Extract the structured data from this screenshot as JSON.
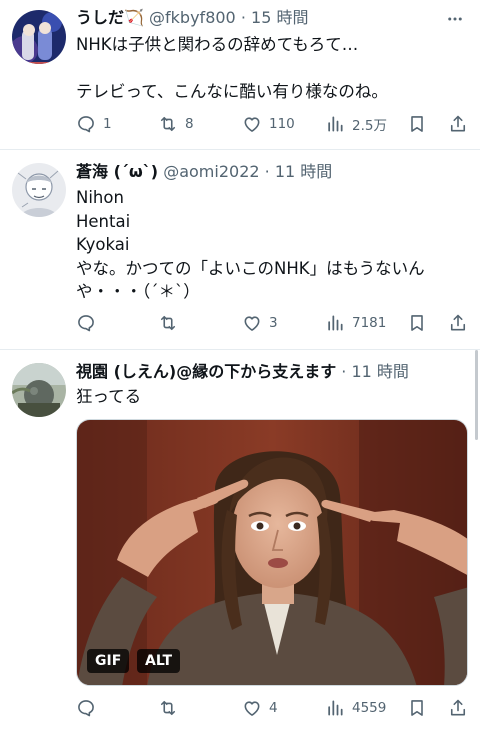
{
  "tweets": [
    {
      "name": "うしだ🏹",
      "handle": "@fkbyf800",
      "sep": "·",
      "time": "15 時間",
      "text": "NHKは子供と関わるの辞めてもろて…\n\nテレビって、こんなに酷い有り様なのね。",
      "replies": "1",
      "retweets": "8",
      "likes": "110",
      "views": "2.5万"
    },
    {
      "name": "蒼海 (´ω`)",
      "handle": "@aomi2022",
      "sep": "·",
      "time": "11 時間",
      "text": "Nihon\nHentai\nKyokai\nやな。かつての「よいこのNHK」はもうないん\nや・・・（´＊`）",
      "replies": "",
      "retweets": "",
      "likes": "3",
      "views": "7181"
    },
    {
      "name": "視園 (しえん)@縁の下から支えます",
      "sep": "·",
      "time": "11 時間",
      "text": "狂ってる",
      "media": {
        "badges": [
          "GIF",
          "ALT"
        ]
      },
      "replies": "",
      "retweets": "",
      "likes": "4",
      "views": "4559"
    }
  ],
  "colors": {
    "text": "#0f1419",
    "muted": "#536471",
    "divider": "#e6ecf0"
  },
  "icons": [
    "reply-icon",
    "retweet-icon",
    "like-icon",
    "views-icon",
    "bookmark-icon",
    "share-icon",
    "more-icon"
  ]
}
